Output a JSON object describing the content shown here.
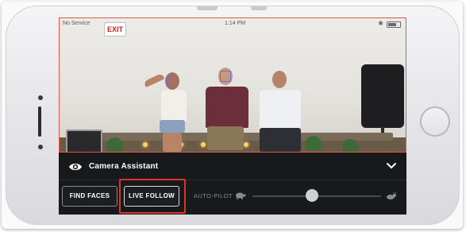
{
  "status_bar": {
    "carrier": "No Service",
    "time": "1:14 PM"
  },
  "video": {
    "exit_sign": "EXIT"
  },
  "assistant": {
    "title": "Camera Assistant",
    "icon": "eye-icon",
    "collapse_icon": "chevron-down-icon"
  },
  "controls": {
    "find_faces_label": "FIND FACES",
    "live_follow_label": "LIVE FOLLOW",
    "autopilot_label": "AUTO-PILOT",
    "autopilot_level": 0.46,
    "slow_icon": "turtle-icon",
    "fast_icon": "rabbit-icon"
  },
  "colors": {
    "highlight": "#e0322d",
    "panel_bg": "#18191b",
    "face_box": "#7a6ad8"
  }
}
